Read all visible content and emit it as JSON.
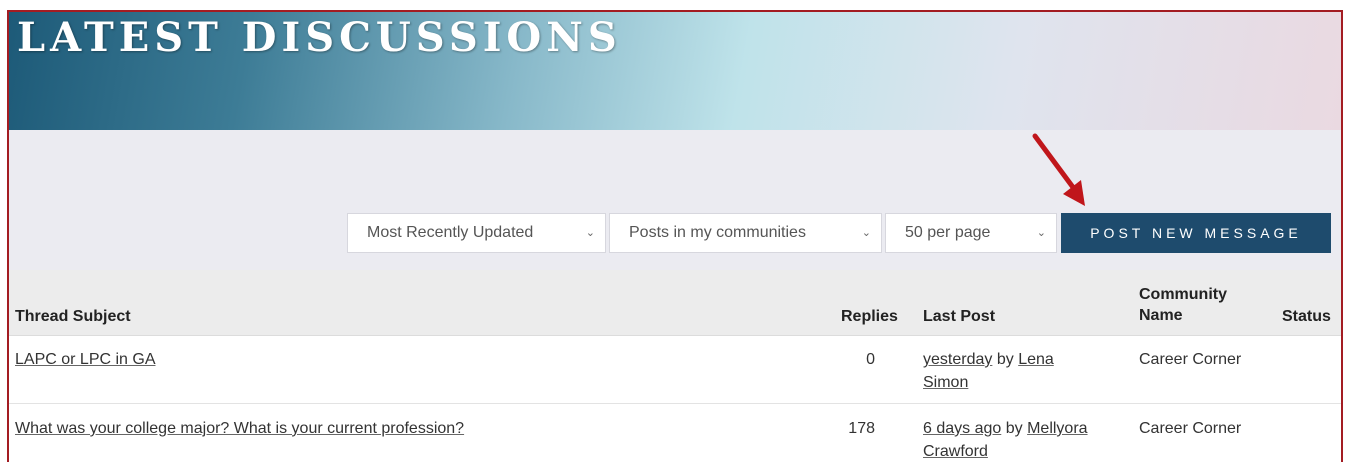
{
  "header": {
    "title": "LATEST DISCUSSIONS"
  },
  "filters": {
    "sort": {
      "selected": "Most Recently Updated"
    },
    "scope": {
      "selected": "Posts in my communities"
    },
    "page_size": {
      "selected": "50 per page"
    }
  },
  "actions": {
    "post_label": "POST NEW MESSAGE"
  },
  "table": {
    "headers": {
      "subject": "Thread Subject",
      "replies": "Replies",
      "last_post": "Last Post",
      "community_line1": "Community",
      "community_line2": "Name",
      "status": "Status"
    },
    "rows": [
      {
        "subject": "LAPC or LPC in GA",
        "replies": "0",
        "when": "yesterday",
        "by": "by",
        "author_line1": "Lena",
        "author_line2": "Simon",
        "community": "Career Corner",
        "status": ""
      },
      {
        "subject": "What was your college major? What is your current profession?",
        "replies": "178",
        "when": "6 days ago",
        "by": "by",
        "author_line1": "Mellyora",
        "author_line2": "Crawford",
        "community": "Career Corner",
        "status": ""
      }
    ]
  },
  "colors": {
    "accent": "#1e4b6d",
    "frame": "#a31c22",
    "arrow": "#c0161b"
  },
  "icons": {
    "dropdown": "chevron-down-icon",
    "annotation": "red-arrow-icon"
  }
}
